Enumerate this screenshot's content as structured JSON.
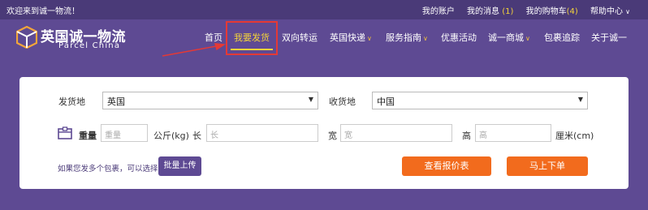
{
  "topbar": {
    "welcome": "欢迎来到诚一物流！",
    "my_account": "我的账户",
    "my_messages": "我的消息",
    "messages_count": "(1)",
    "cart": "我的购物车",
    "cart_count": "(4)",
    "help_center": "帮助中心",
    "help_caret": "∨"
  },
  "logo": {
    "title": "英国诚一物流",
    "subtitle": "Parcel China"
  },
  "nav": {
    "items": [
      {
        "label": "首页"
      },
      {
        "label": "我要发货"
      },
      {
        "label": "双向转运"
      },
      {
        "label": "英国快递"
      },
      {
        "label": "服务指南"
      },
      {
        "label": "优惠活动"
      },
      {
        "label": "诚一商城"
      },
      {
        "label": "包裹追踪"
      },
      {
        "label": "关于诚一"
      }
    ],
    "caret": "∨"
  },
  "form": {
    "origin_label": "发货地",
    "origin_value": "英国",
    "destination_label": "收货地",
    "destination_value": "中国",
    "dropdown_caret": "▼",
    "weight_label": "重量",
    "weight_placeholder": "重量",
    "weight_unit": "公斤(kg)",
    "length_label": "长",
    "length_placeholder": "长",
    "width_label": "宽",
    "width_placeholder": "宽",
    "height_label": "高",
    "height_placeholder": "高",
    "dim_unit": "厘米(cm)",
    "multi_note": "如果您发多个包裹，可以选择",
    "bulk_upload": "批量上传",
    "view_quote": "查看报价表",
    "order_now": "马上下单"
  },
  "colors": {
    "brand_purple": "#5e4a93",
    "topbar": "#4a3a78",
    "accent_yellow": "#f3d23a",
    "orange_button": "#f26b1d",
    "annotation_red": "#e53935"
  }
}
